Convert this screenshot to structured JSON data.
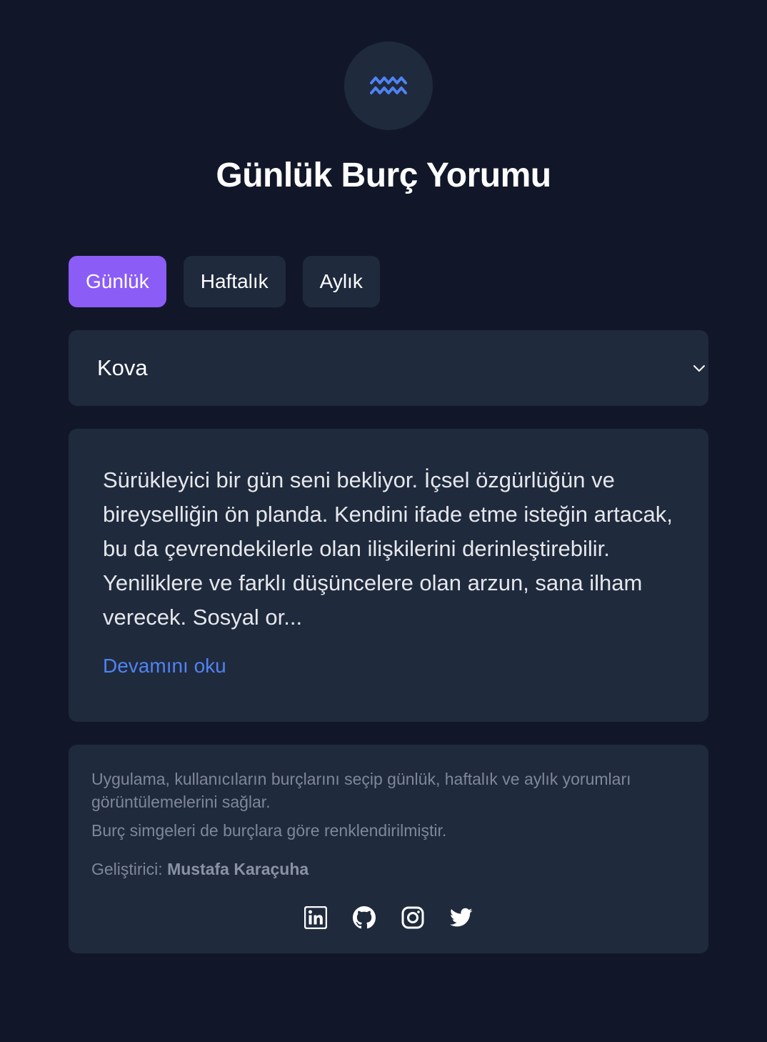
{
  "header": {
    "logo_icon": "aquarius-icon",
    "logo_color": "#4f83f1",
    "title": "Günlük Burç Yorumu"
  },
  "tabs": [
    {
      "label": "Günlük",
      "active": true
    },
    {
      "label": "Haftalık",
      "active": false
    },
    {
      "label": "Aylık",
      "active": false
    }
  ],
  "sign_select": {
    "value": "Kova",
    "icon": "chevron-down-icon"
  },
  "horoscope": {
    "text": "Sürükleyici bir gün seni bekliyor. İçsel özgürlüğün ve bireyselliğin ön planda. Kendini ifade etme isteğin artacak, bu da çevrendekilerle olan ilişkilerini derinleştirebilir. Yeniliklere ve farklı düşüncelere olan arzun, sana ilham verecek. Sosyal or...",
    "read_more": "Devamını oku"
  },
  "footer": {
    "description": "Uygulama, kullanıcıların burçlarını seçip günlük, haftalık ve aylık yorumları görüntülemelerini sağlar.",
    "note": "Burç simgeleri de burçlara göre renklendirilmiştir.",
    "developer_label": "Geliştirici:",
    "developer_name": "Mustafa Karaçuha",
    "socials": [
      "linkedin-icon",
      "github-icon",
      "instagram-icon",
      "twitter-icon"
    ]
  },
  "colors": {
    "background": "#111729",
    "card": "#1f2a3d",
    "accent": "#8b5cf6",
    "link": "#4f83f1"
  }
}
